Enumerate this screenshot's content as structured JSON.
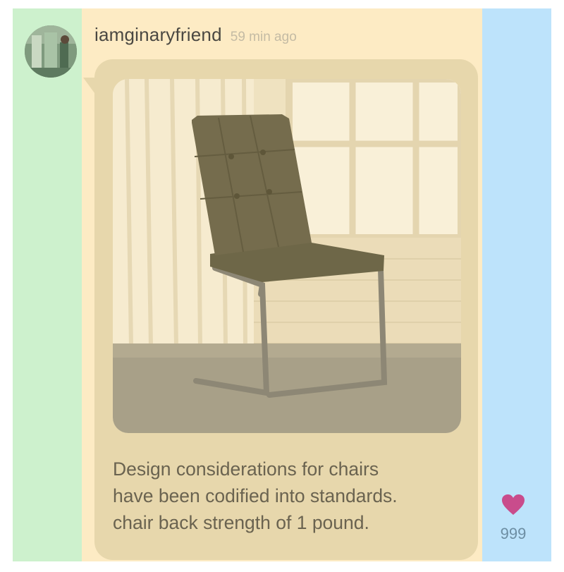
{
  "post": {
    "username": "iamginaryfriend",
    "time_ago": "59 min ago",
    "caption_lines": [
      "Design considerations for chairs",
      "have been codified into standards.",
      "chair back strength of 1 pound."
    ],
    "likes_count": "999"
  },
  "icons": {
    "like": "heart-icon"
  },
  "colors": {
    "left_column": "#cdf1cd",
    "middle_column": "#fdebc4",
    "right_column": "#bde3fb",
    "bubble": "#e7d7ac",
    "heart": "#c94c8c",
    "likes_text": "#6d8ea3"
  }
}
